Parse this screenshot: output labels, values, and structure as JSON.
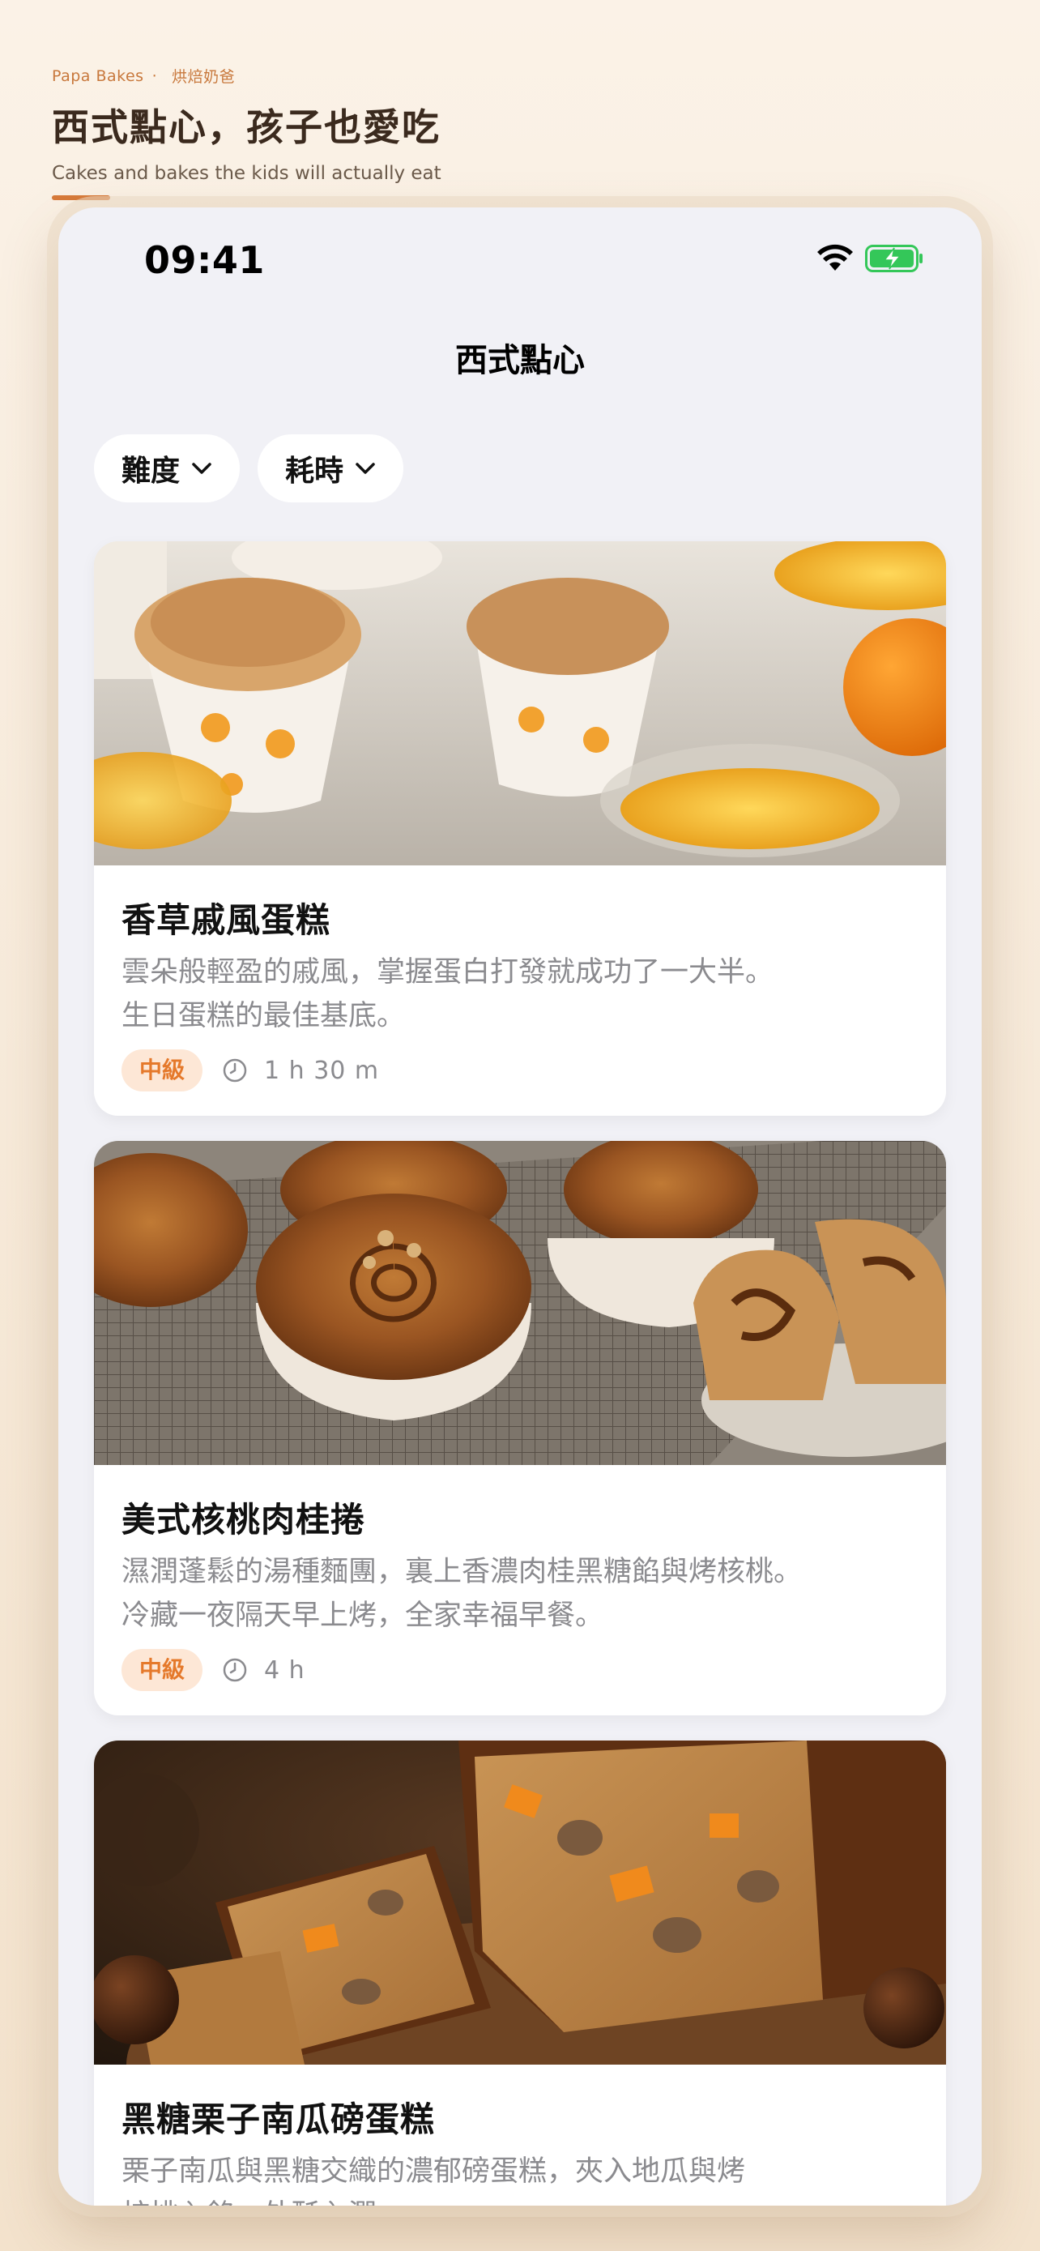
{
  "page": {
    "brand_en": "Papa Bakes",
    "brand_separator": "·",
    "brand_zh": "烘焙奶爸",
    "headline": "西式點心，孩子也愛吃",
    "subline": "Cakes and bakes the kids will actually eat"
  },
  "status_bar": {
    "time": "09:41",
    "wifi_icon": "wifi-icon",
    "battery_icon": "battery-charging-icon"
  },
  "nav": {
    "title": "西式點心"
  },
  "filters": [
    {
      "label": "難度",
      "icon": "chevron-down-icon"
    },
    {
      "label": "耗時",
      "icon": "chevron-down-icon"
    }
  ],
  "recipes": [
    {
      "title": "香草戚風蛋糕",
      "desc_line1": "雲朵般輕盈的戚風，掌握蛋白打發就成功了一大半。",
      "desc_line2": "生日蛋糕的最佳基底。",
      "difficulty": "中級",
      "duration": "1 h 30 m",
      "photo": "chiffon-cake-cups-with-orange-photo"
    },
    {
      "title": "美式核桃肉桂捲",
      "desc_line1": "濕潤蓬鬆的湯種麵團，裏上香濃肉桂黑糖餡與烤核桃。",
      "desc_line2": "冷藏一夜隔天早上烤，全家幸福早餐。",
      "difficulty": "中級",
      "duration": "4 h",
      "photo": "walnut-cinnamon-rolls-photo"
    },
    {
      "title": "黑糖栗子南瓜磅蛋糕",
      "desc_line1": "栗子南瓜與黑糖交織的濃郁磅蛋糕，夾入地瓜與烤",
      "desc_line2": "核桃內餡，外酥內潤。",
      "photo": "chestnut-pumpkin-pound-cake-photo"
    }
  ],
  "colors": {
    "accent": "#d77a3a",
    "badge_bg": "#fde7d6",
    "badge_text": "#e5792b",
    "battery_green": "#34c759"
  }
}
